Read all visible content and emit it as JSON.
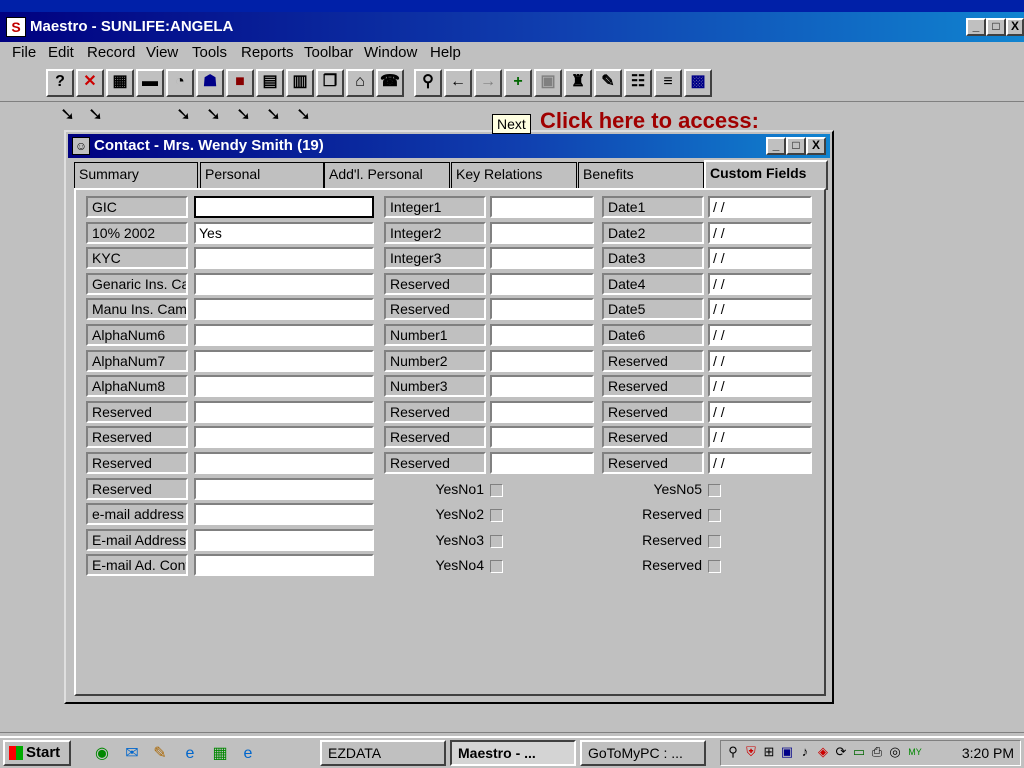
{
  "app": {
    "title": "Maestro - SUNLIFE:ANGELA",
    "window_buttons": [
      "_",
      "□",
      "X"
    ]
  },
  "menu": [
    "File",
    "Edit",
    "Record",
    "View",
    "Tools",
    "Reports",
    "Toolbar",
    "Window",
    "Help"
  ],
  "toolbar_icons": [
    "help-icon",
    "cancel-icon",
    "calculator-icon",
    "minus-icon",
    "gauge-icon",
    "contacts-icon",
    "book-icon",
    "list-icon",
    "report-icon",
    "copy-icon",
    "folder-icon",
    "phone-icon",
    "search-icon",
    "back-arrow-icon",
    "forward-arrow-icon",
    "add-icon",
    "save-icon",
    "delete-icon",
    "edit-icon",
    "table-icon",
    "notes-icon",
    "grid-icon"
  ],
  "workspace": {
    "promo_text": "Click here to access:",
    "tooltip": "Next"
  },
  "contact": {
    "title": "Contact - Mrs. Wendy Smith (19)",
    "tabs": [
      "Summary",
      "Personal",
      "Add'l. Personal",
      "Key Relations",
      "Benefits",
      "Custom Fields"
    ],
    "active_tab": "Custom Fields",
    "col1": [
      {
        "label": "GIC",
        "value": ""
      },
      {
        "label": "10% 2002",
        "value": "Yes"
      },
      {
        "label": "KYC",
        "value": ""
      },
      {
        "label": "Genaric Ins. Ca",
        "value": ""
      },
      {
        "label": "Manu Ins. Camp",
        "value": ""
      },
      {
        "label": "AlphaNum6",
        "value": ""
      },
      {
        "label": "AlphaNum7",
        "value": ""
      },
      {
        "label": "AlphaNum8",
        "value": ""
      },
      {
        "label": "Reserved",
        "value": ""
      },
      {
        "label": "Reserved",
        "value": ""
      },
      {
        "label": "Reserved",
        "value": ""
      },
      {
        "label": "Reserved",
        "value": ""
      },
      {
        "label": "e-mail address",
        "value": ""
      },
      {
        "label": "E-mail Address",
        "value": ""
      },
      {
        "label": "E-mail Ad. Conti",
        "value": ""
      }
    ],
    "col2": [
      {
        "label": "Integer1",
        "value": ""
      },
      {
        "label": "Integer2",
        "value": ""
      },
      {
        "label": "Integer3",
        "value": ""
      },
      {
        "label": "Reserved",
        "value": ""
      },
      {
        "label": "Reserved",
        "value": ""
      },
      {
        "label": "Number1",
        "value": ""
      },
      {
        "label": "Number2",
        "value": ""
      },
      {
        "label": "Number3",
        "value": ""
      },
      {
        "label": "Reserved",
        "value": ""
      },
      {
        "label": "Reserved",
        "value": ""
      },
      {
        "label": "Reserved",
        "value": ""
      }
    ],
    "col3": [
      {
        "label": "Date1",
        "value": " / /"
      },
      {
        "label": "Date2",
        "value": " / /"
      },
      {
        "label": "Date3",
        "value": " / /"
      },
      {
        "label": "Date4",
        "value": " / /"
      },
      {
        "label": "Date5",
        "value": " / /"
      },
      {
        "label": "Date6",
        "value": " / /"
      },
      {
        "label": "Reserved",
        "value": " / /"
      },
      {
        "label": "Reserved",
        "value": " / /"
      },
      {
        "label": "Reserved",
        "value": " / /"
      },
      {
        "label": "Reserved",
        "value": " / /"
      },
      {
        "label": "Reserved",
        "value": " / /"
      }
    ],
    "checks_mid": [
      "YesNo1",
      "YesNo2",
      "YesNo3",
      "YesNo4"
    ],
    "checks_right": [
      "YesNo5",
      "Reserved",
      "Reserved",
      "Reserved"
    ]
  },
  "taskbar": {
    "start_label": "Start",
    "tasks": [
      "EZDATA",
      "Maestro - ...",
      "GoToMyPC : ..."
    ],
    "active_task": "Maestro - ...",
    "clock": "3:20 PM"
  }
}
